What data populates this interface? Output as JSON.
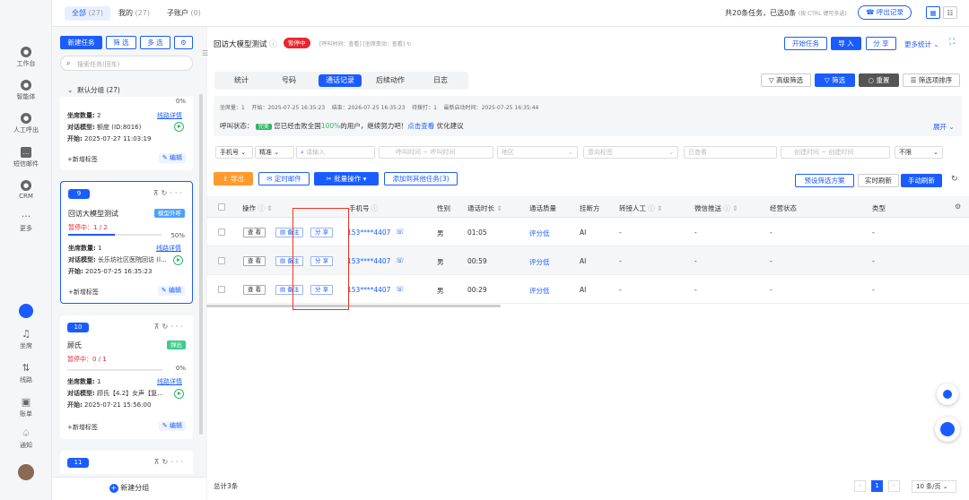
{
  "topbar": {
    "tabs": [
      {
        "label": "全部",
        "count": "(27)"
      },
      {
        "label": "我的",
        "count": "(27)"
      },
      {
        "label": "子账户",
        "count": "(0)"
      }
    ],
    "summary": "共20条任务，已选0条",
    "summary_hint": "(按 CTRL 键可多选)",
    "call_record_button": "呼出记录"
  },
  "leftnav": {
    "items": [
      {
        "label": "工作台",
        "icon": "dashboard-icon"
      },
      {
        "label": "智能体",
        "icon": "agent-icon"
      },
      {
        "label": "人工呼出",
        "icon": "manual-call-icon"
      },
      {
        "label": "短信邮件",
        "icon": "sms-icon"
      },
      {
        "label": "CRM",
        "icon": "crm-icon"
      },
      {
        "label": "更多",
        "icon": "more-icon"
      }
    ],
    "bottom": [
      {
        "label": "坐席",
        "icon": "headset-icon"
      },
      {
        "label": "线路",
        "icon": "line-icon"
      },
      {
        "label": "账单",
        "icon": "bill-icon"
      },
      {
        "label": "通知",
        "icon": "bell-icon"
      }
    ]
  },
  "sidebar": {
    "new_task": "新建任务",
    "filter": "筛 选",
    "multi_select": "多 选",
    "search_placeholder": "搜索任务(回车)",
    "group_label": "默认分组 (27)",
    "new_group": "新建分组",
    "cards": [
      {
        "seats_label": "坐席数量:",
        "seats": "2",
        "detail_link": "线路详情",
        "model_label": "对话模型:",
        "model": "额度 (ID:8016)",
        "start_label": "开始:",
        "start": "2025-07-27 11:03:19",
        "add_tag": "+新增标签",
        "edit": "编辑",
        "pct_top": "0%"
      },
      {
        "num": "9",
        "title": "回访大模型测试",
        "tag": "模型外呼",
        "status": "暂停中：1 / 2",
        "pct": "50%",
        "progress": 0.5,
        "seats_label": "坐席数量:",
        "seats": "1",
        "detail_link": "线路详情",
        "model_label": "对话模型:",
        "model": "长乐坊社区医院回访 (l...",
        "start_label": "开始:",
        "start": "2025-07-25 16:35:23",
        "add_tag": "+新增标签",
        "edit": "编辑"
      },
      {
        "num": "10",
        "title": "顾氏",
        "tag": "弹出",
        "status": "暂停中：0 / 1",
        "pct": "0%",
        "progress": 0,
        "seats_label": "坐席数量:",
        "seats": "1",
        "detail_link": "线路详情",
        "model_label": "对话模型:",
        "model": "顾氏【4.2】女声【复...",
        "start_label": "开始:",
        "start": "2025-07-21 15:56:00",
        "add_tag": "+新增标签",
        "edit": "编辑"
      },
      {
        "num": "11"
      }
    ]
  },
  "main": {
    "task_title": "回访大模型测试",
    "status_badge": "暂停中",
    "meta": "[呼叫时间：查看] [坐席变动：查看]",
    "buttons": {
      "start": "开始任务",
      "import": "导 入",
      "share": "分 享",
      "more_stats": "更多统计"
    },
    "tabs": [
      "统计",
      "号码",
      "通话记录",
      "后续动作",
      "日志"
    ],
    "active_tab": "通话记录",
    "filter_buttons": {
      "advanced": "高级筛选",
      "filter": "筛选",
      "reset": "重置",
      "sort": "筛选项排序"
    },
    "info_line": "坐席量：1    开始：2025-07-25 16:35:23    结束：2026-07-25 16:35:23    待拨打：1    最新启动时间：2025-07-25 16:35:44",
    "call_status_label": "呼叫状态：",
    "call_status_badge": "完美",
    "call_status_text_a": "您已经击败全国",
    "call_status_pct": "100%",
    "call_status_text_b": "的用户，继续努力吧！",
    "call_status_link": "点击查看",
    "call_status_text_c": "优化建议",
    "expand": "展开",
    "filters": {
      "phone_select": "手机号",
      "exact_select": "精准",
      "search_placeholder": "请输入",
      "call_time_start": "呼叫时间",
      "call_time_end": "呼叫时间",
      "region": "地区",
      "intent": "意向标签",
      "viewed": "已查看",
      "created_start": "创建时间",
      "created_end": "创建时间",
      "limit": "不限"
    },
    "actions": {
      "export": "导出",
      "scheduled_mail": "定时邮件",
      "batch": "批量操作",
      "add_other": "添加到其他任务(3)",
      "preset": "预设筛选方案",
      "realtime": "实时刷新",
      "manual": "手动刷新"
    },
    "columns": [
      "操作",
      "手机号",
      "性别",
      "通话时长",
      "通话质量",
      "挂断方",
      "转接人工",
      "微信推送",
      "经营状态",
      "类型"
    ],
    "row_buttons": [
      "查 看",
      "备注",
      "分 享"
    ],
    "rows": [
      {
        "phone": "153****4407",
        "gender": "男",
        "duration": "01:05",
        "quality": "评分低",
        "hangup": "AI",
        "transfer": "-",
        "wechat": "-",
        "business": "-",
        "type": "-"
      },
      {
        "phone": "153****4407",
        "gender": "男",
        "duration": "00:59",
        "quality": "评分低",
        "hangup": "AI",
        "transfer": "-",
        "wechat": "-",
        "business": "-",
        "type": "-"
      },
      {
        "phone": "153****4407",
        "gender": "男",
        "duration": "00:29",
        "quality": "评分低",
        "hangup": "AI",
        "transfer": "-",
        "wechat": "-",
        "business": "-",
        "type": "-"
      }
    ],
    "total": "总计3条",
    "pagination": {
      "current": "1",
      "page_size": "10 条/页"
    }
  }
}
